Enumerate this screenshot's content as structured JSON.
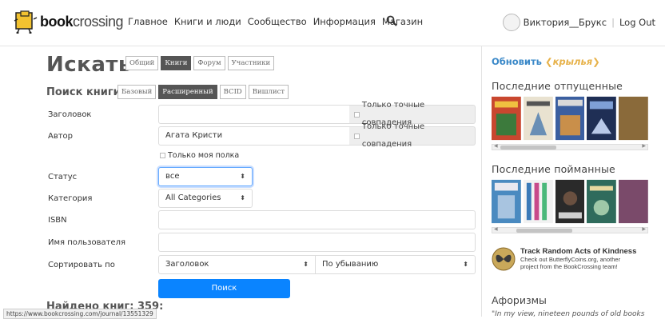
{
  "header": {
    "logo_bold": "book",
    "logo_light": "crossing",
    "nav": [
      "Главное",
      "Книги и люди",
      "Сообщество",
      "Информация",
      "Магазин"
    ],
    "user_name": "Виктория__Брукс",
    "logout": "Log Out"
  },
  "main": {
    "title": "Искать",
    "top_tabs": [
      "Общий",
      "Книги",
      "Форум",
      "Участники"
    ],
    "sub_title": "Поиск книги",
    "sub_tabs": [
      "Базовый",
      "Расширенный",
      "BCID",
      "Вишлист"
    ],
    "fields": {
      "title_label": "Заголовок",
      "title_value": "",
      "exact_match": "Только точные совпадения",
      "author_label": "Автор",
      "author_value": "Агата Кристи",
      "my_shelf": "Только моя полка",
      "status_label": "Статус",
      "status_value": "все",
      "category_label": "Категория",
      "category_value": "All Categories",
      "isbn_label": "ISBN",
      "isbn_value": "",
      "username_label": "Имя пользователя",
      "username_value": "",
      "sort_label": "Сортировать по",
      "sort_value": "Заголовок",
      "order_value": "По убыванию"
    },
    "search_button": "Поиск",
    "found": "Найдено книг: 359:",
    "status_url": "https://www.bookcrossing.com/journal/13551329"
  },
  "sidebar": {
    "refresh": "Обновить",
    "wings": "крылья",
    "released_title": "Последние отпущенные",
    "caught_title": "Последние пойманные",
    "promo_title": "Track Random Acts of Kindness",
    "promo_line1": "Check out ButterflyCoins.org, another",
    "promo_line2": "project from the BookCrossing team!",
    "aph_title": "Афоризмы",
    "aph_text": "\"In my view, nineteen pounds of old books"
  },
  "colors": {
    "primary": "#0a84ff",
    "link": "#3a88c8",
    "active_tab": "#555555"
  }
}
